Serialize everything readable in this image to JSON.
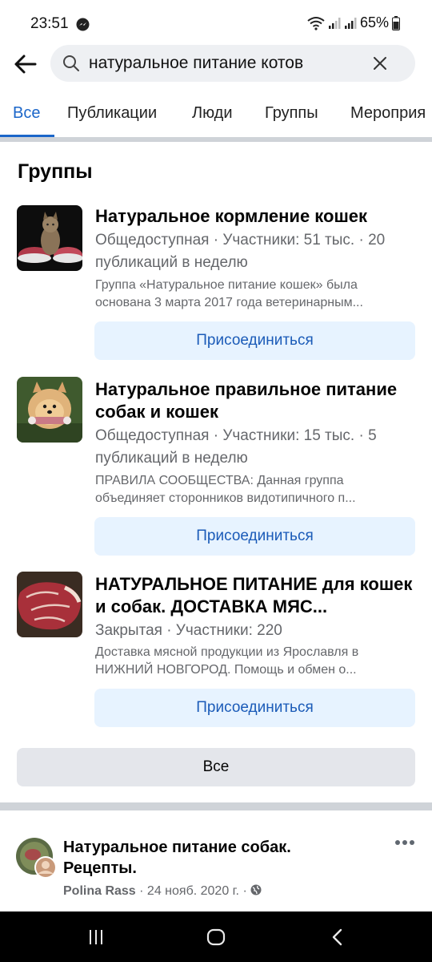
{
  "status": {
    "time": "23:51",
    "battery": "65%"
  },
  "search": {
    "query": "натуральное питание котов"
  },
  "tabs": [
    {
      "label": "Все",
      "active": true
    },
    {
      "label": "Публикации"
    },
    {
      "label": "Люди"
    },
    {
      "label": "Группы"
    },
    {
      "label": "Мероприя"
    }
  ],
  "groups_section": {
    "title": "Группы",
    "items": [
      {
        "name": "Натуральное кормление кошек",
        "meta": "Общедоступная · Участники: 51 тыс. · 20 публикаций в неделю",
        "description": "Группа «Натуральное питание кошек» была основана 3 марта 2017 года ветеринарным...",
        "join_label": "Присоединиться"
      },
      {
        "name": "Натуральное правильное питание собак и кошек",
        "meta": "Общедоступная · Участники: 15 тыс. · 5 публикаций в неделю",
        "description": "ПРАВИЛА СООБЩЕСТВА: Данная группа объединяет сторонников видотипичного п...",
        "join_label": "Присоединиться"
      },
      {
        "name": "НАТУРАЛЬНОЕ ПИТАНИЕ для кошек и собак. ДОСТАВКА МЯС...",
        "meta": "Закрытая · Участники: 220",
        "description": "Доставка мясной продукции из Ярославля в НИЖНИЙ НОВГОРОД. Помощь и обмен о...",
        "join_label": "Присоединиться"
      }
    ],
    "see_all_label": "Все"
  },
  "post": {
    "group_name": "Натуральное питание собак. Рецепты.",
    "author": "Polina Rass",
    "date": "· 24 нояб. 2020 г. ·"
  },
  "colors": {
    "accent": "#1b66c9",
    "join_bg": "#e7f3ff",
    "secondary_text": "#65676b"
  }
}
